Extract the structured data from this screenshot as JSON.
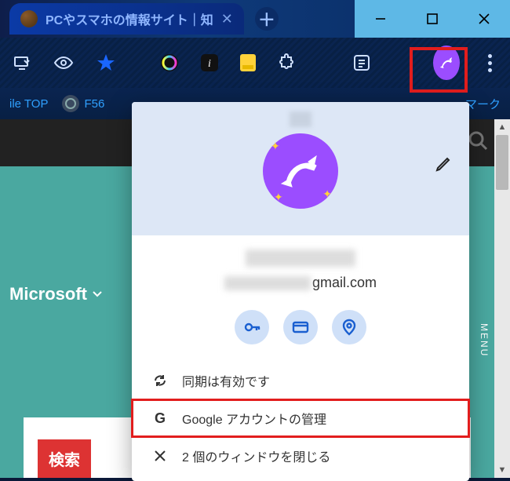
{
  "tab": {
    "title": "PCやスマホの情報サイト｜知"
  },
  "bookmarks": {
    "left1": "ile TOP",
    "left2": "F56",
    "right": "マーク"
  },
  "page": {
    "ms": "Microsoft",
    "menu": "MENU",
    "search_btn": "検索"
  },
  "profile": {
    "email_visible_suffix": "gmail.com",
    "rows": {
      "sync": "同期は有効です",
      "manage": "Google アカウントの管理",
      "close_windows": "2 個のウィンドウを閉じる"
    }
  }
}
